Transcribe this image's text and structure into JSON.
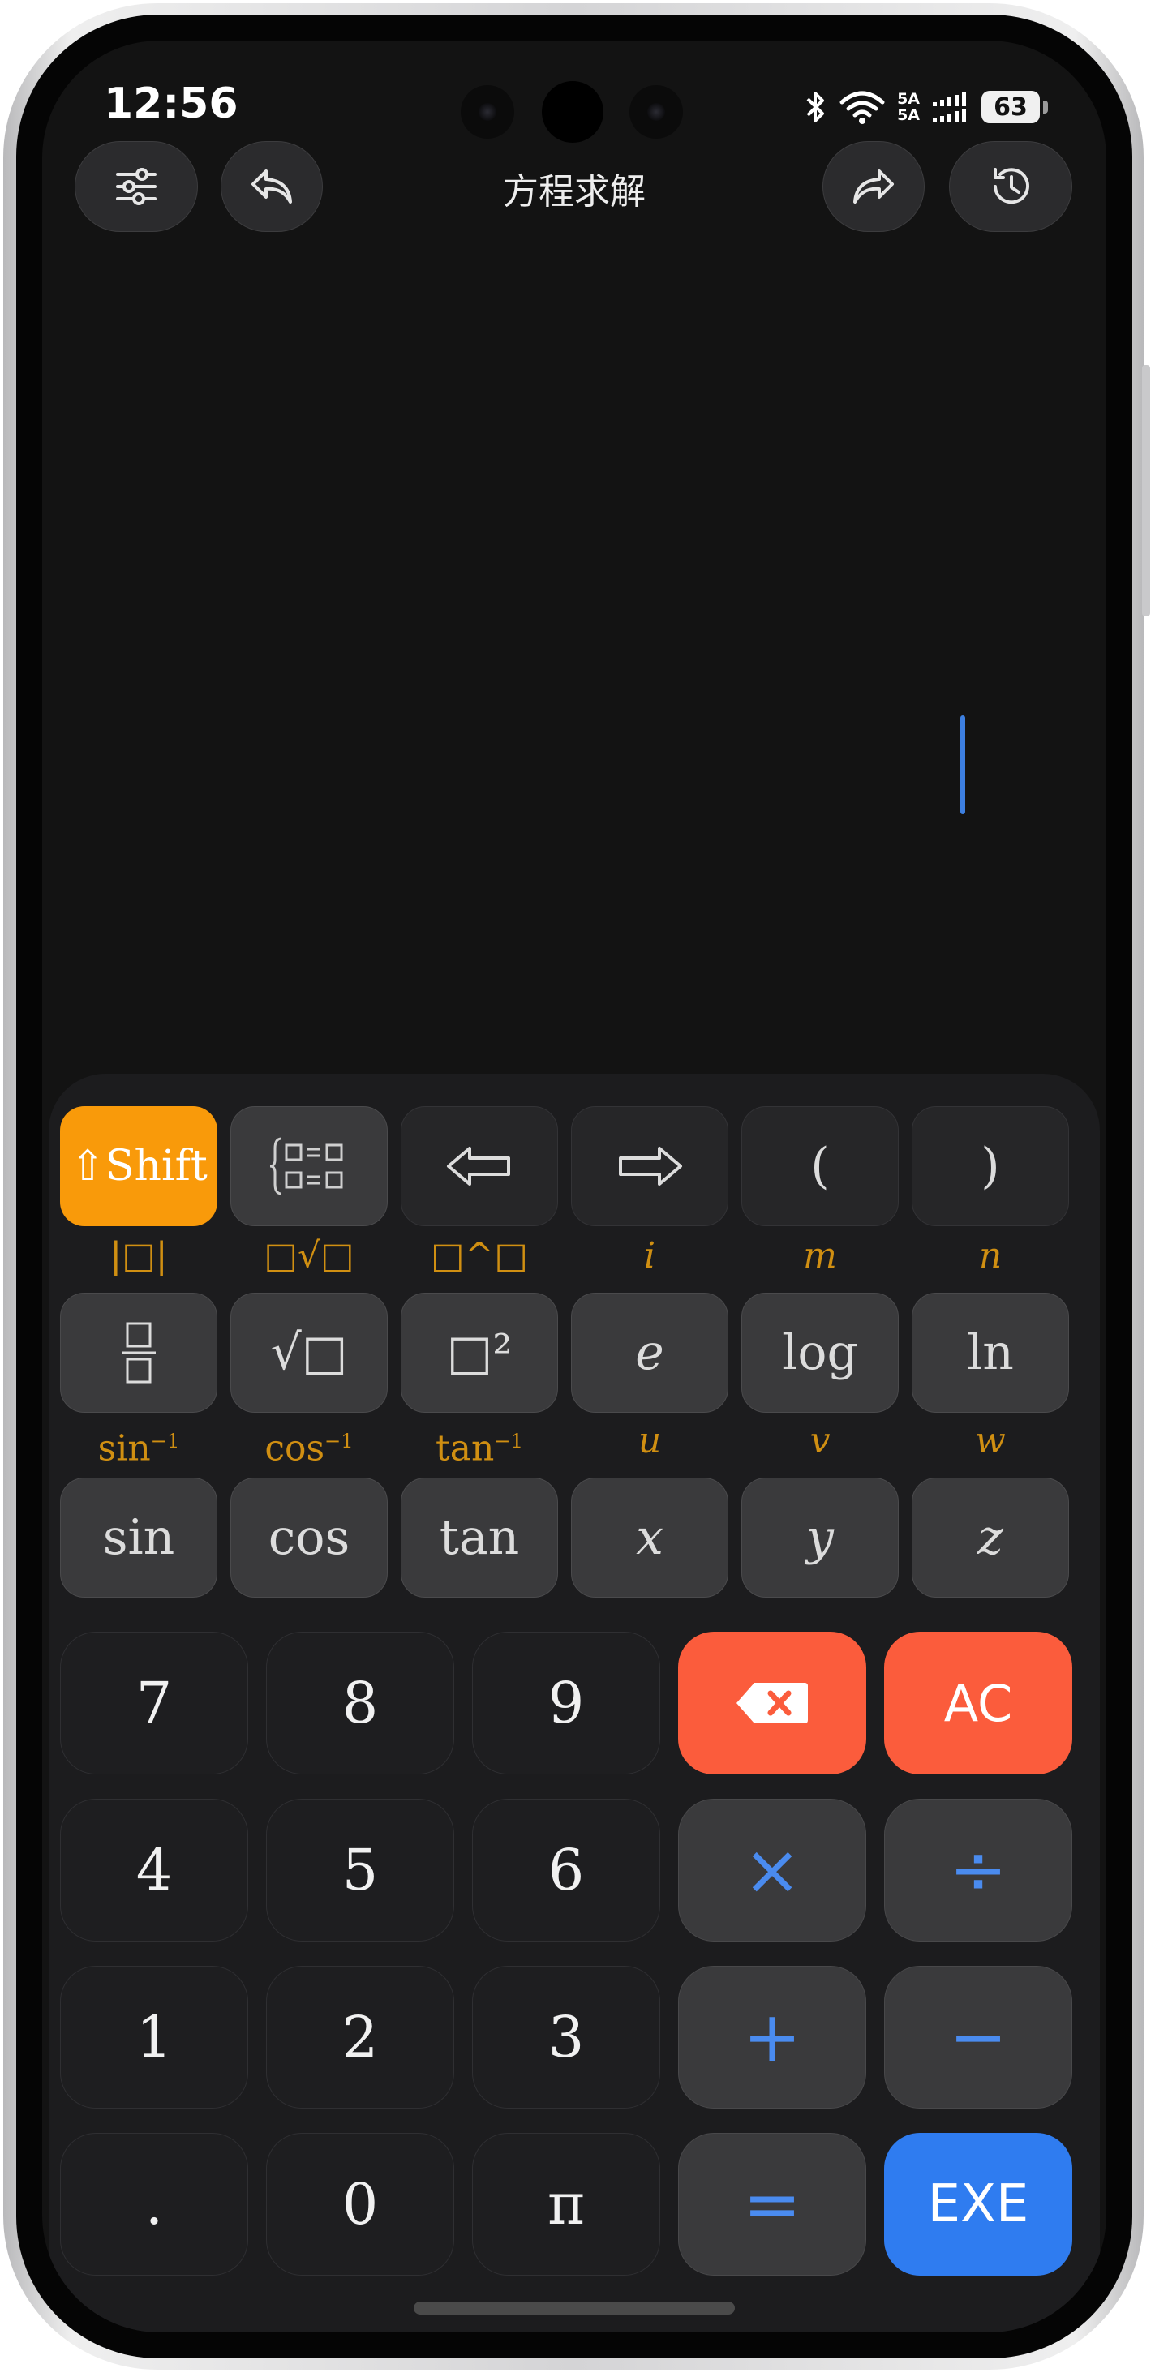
{
  "status_bar": {
    "time": "12:56",
    "network_line1": "5A",
    "network_line2": "5A",
    "battery": "63",
    "icons": [
      "bluetooth-icon",
      "wifi-icon",
      "signal-icon",
      "battery-icon"
    ]
  },
  "header": {
    "title": "方程求解",
    "left_buttons": [
      "settings-sliders-icon",
      "undo-icon"
    ],
    "right_buttons": [
      "redo-icon",
      "history-clock-icon"
    ]
  },
  "keypad": {
    "row1": {
      "shift": "⇧Shift",
      "system": "system-of-equations-icon",
      "left": "left-arrow-icon",
      "right": "right-arrow-icon",
      "lparen": "(",
      "rparen": ")"
    },
    "row2_secondary": {
      "abs": "|□|",
      "nroot": "□√□",
      "power": "□^□",
      "i": "i",
      "m": "m",
      "n": "n"
    },
    "row2": {
      "fraction": "fraction-icon",
      "sqrt": "√□",
      "square": "□²",
      "e": "e",
      "log": "log",
      "ln": "ln"
    },
    "row3_secondary": {
      "asin_base": "sin",
      "asin_exp": "−1",
      "acos_base": "cos",
      "acos_exp": "−1",
      "atan_base": "tan",
      "atan_exp": "−1",
      "u": "u",
      "v": "v",
      "w": "w"
    },
    "row3": {
      "sin": "sin",
      "cos": "cos",
      "tan": "tan",
      "x": "x",
      "y": "y",
      "z": "z"
    },
    "digits": {
      "seven": "7",
      "eight": "8",
      "nine": "9",
      "four": "4",
      "five": "5",
      "six": "6",
      "one": "1",
      "two": "2",
      "three": "3",
      "dot": ".",
      "zero": "0",
      "pi": "π"
    },
    "ops": {
      "backspace": "backspace-icon",
      "ac": "AC",
      "multiply": "×",
      "divide": "÷",
      "plus": "+",
      "minus": "−",
      "equals": "=",
      "exe": "EXE"
    }
  },
  "colors": {
    "shift": "#f99a0a",
    "danger": "#fb5c3c",
    "exe": "#2f7cf0",
    "operator": "#4a8bef",
    "secondary_label": "#d08f12",
    "cursor": "#3d7fe0"
  }
}
